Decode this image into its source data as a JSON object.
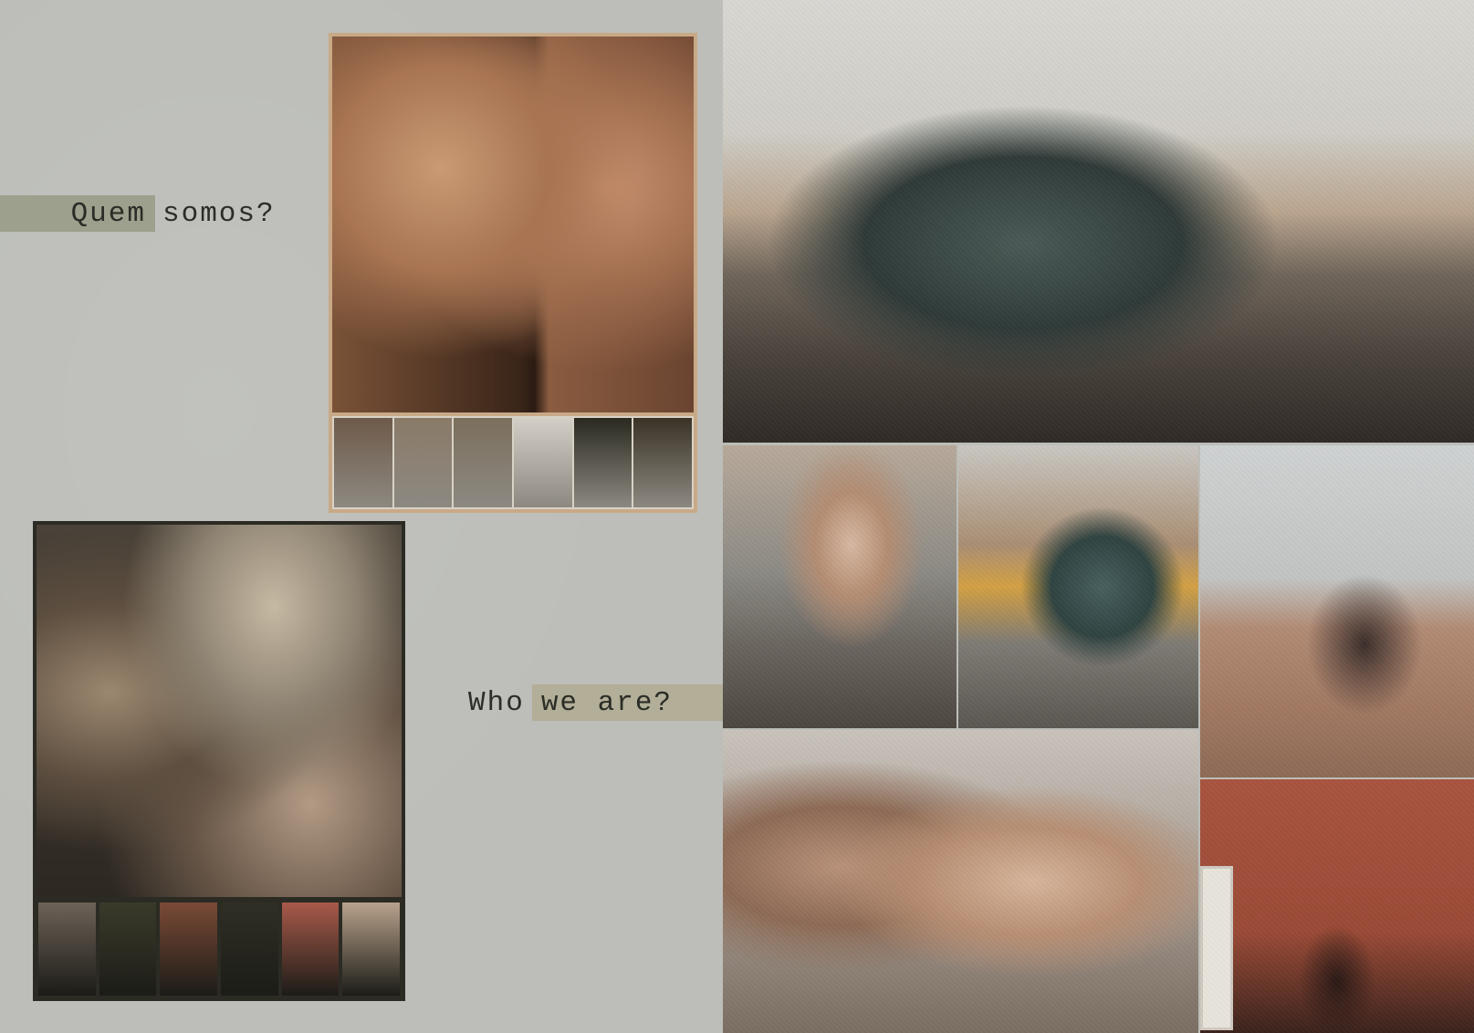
{
  "titles": {
    "pt": {
      "highlight": "Quem",
      "rest": "somos?"
    },
    "en": {
      "plain": "Who",
      "highlight": "we are?"
    }
  },
  "colors": {
    "background": "#bdbeb9",
    "title_highlight_pt": "#9da08d",
    "title_highlight_en": "#b2ae98",
    "text": "#2b2d26",
    "frame_top": "#c8a987",
    "frame_bottom": "#2b2b24"
  },
  "thumbnails_top": [
    {
      "tone": "#6e5a4a"
    },
    {
      "tone": "#8a7a68"
    },
    {
      "tone": "#7b6f5d"
    },
    {
      "tone": "#d3cfc7"
    },
    {
      "tone": "#2a2a20"
    },
    {
      "tone": "#3a3326"
    }
  ],
  "thumbnails_bottom": [
    {
      "tone": "#6d6257"
    },
    {
      "tone": "#3a3a2a"
    },
    {
      "tone": "#7a4a36"
    },
    {
      "tone": "#2f2f25"
    },
    {
      "tone": "#a85a4a"
    },
    {
      "tone": "#b8a28c"
    }
  ]
}
